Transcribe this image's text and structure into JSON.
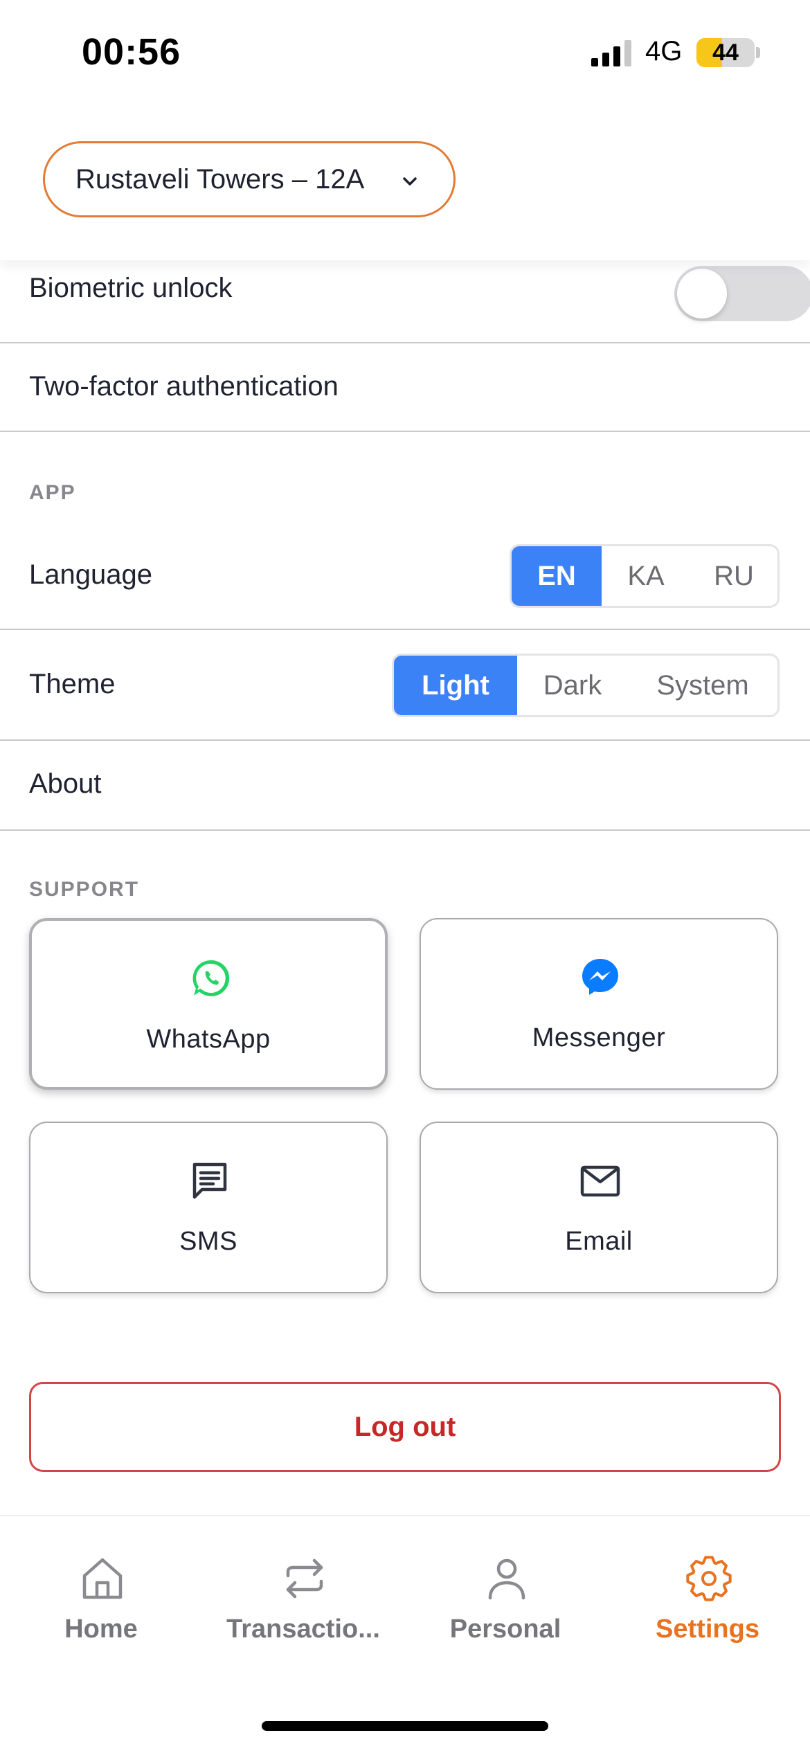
{
  "status_bar": {
    "time": "00:56",
    "network": "4G",
    "battery": "44",
    "battery_fraction": 0.44
  },
  "property_selector": {
    "label": "Rustaveli Towers – 12A"
  },
  "security": {
    "biometric_label": "Biometric unlock",
    "biometric_enabled": false,
    "two_factor_label": "Two-factor authentication"
  },
  "app_section": {
    "header": "APP",
    "language_label": "Language",
    "language_options": [
      "EN",
      "KA",
      "RU"
    ],
    "language_selected": "EN",
    "theme_label": "Theme",
    "theme_options": [
      "Light",
      "Dark",
      "System"
    ],
    "theme_selected": "Light",
    "about_label": "About"
  },
  "support_section": {
    "header": "SUPPORT",
    "cards": [
      {
        "label": "WhatsApp",
        "icon": "whatsapp-icon"
      },
      {
        "label": "Messenger",
        "icon": "messenger-icon"
      },
      {
        "label": "SMS",
        "icon": "sms-icon"
      },
      {
        "label": "Email",
        "icon": "email-icon"
      }
    ]
  },
  "logout": {
    "label": "Log out"
  },
  "tab_bar": {
    "tabs": [
      {
        "label": "Home",
        "icon": "home-icon"
      },
      {
        "label": "Transactio...",
        "icon": "transactions-icon"
      },
      {
        "label": "Personal",
        "icon": "person-icon"
      },
      {
        "label": "Settings",
        "icon": "gear-icon"
      }
    ],
    "active": "Settings"
  },
  "colors": {
    "accent_orange": "#e8721f",
    "accent_blue": "#3b82f6",
    "danger_red": "#c62828",
    "whatsapp_green": "#25d366",
    "messenger_blue": "#0a7cff"
  }
}
